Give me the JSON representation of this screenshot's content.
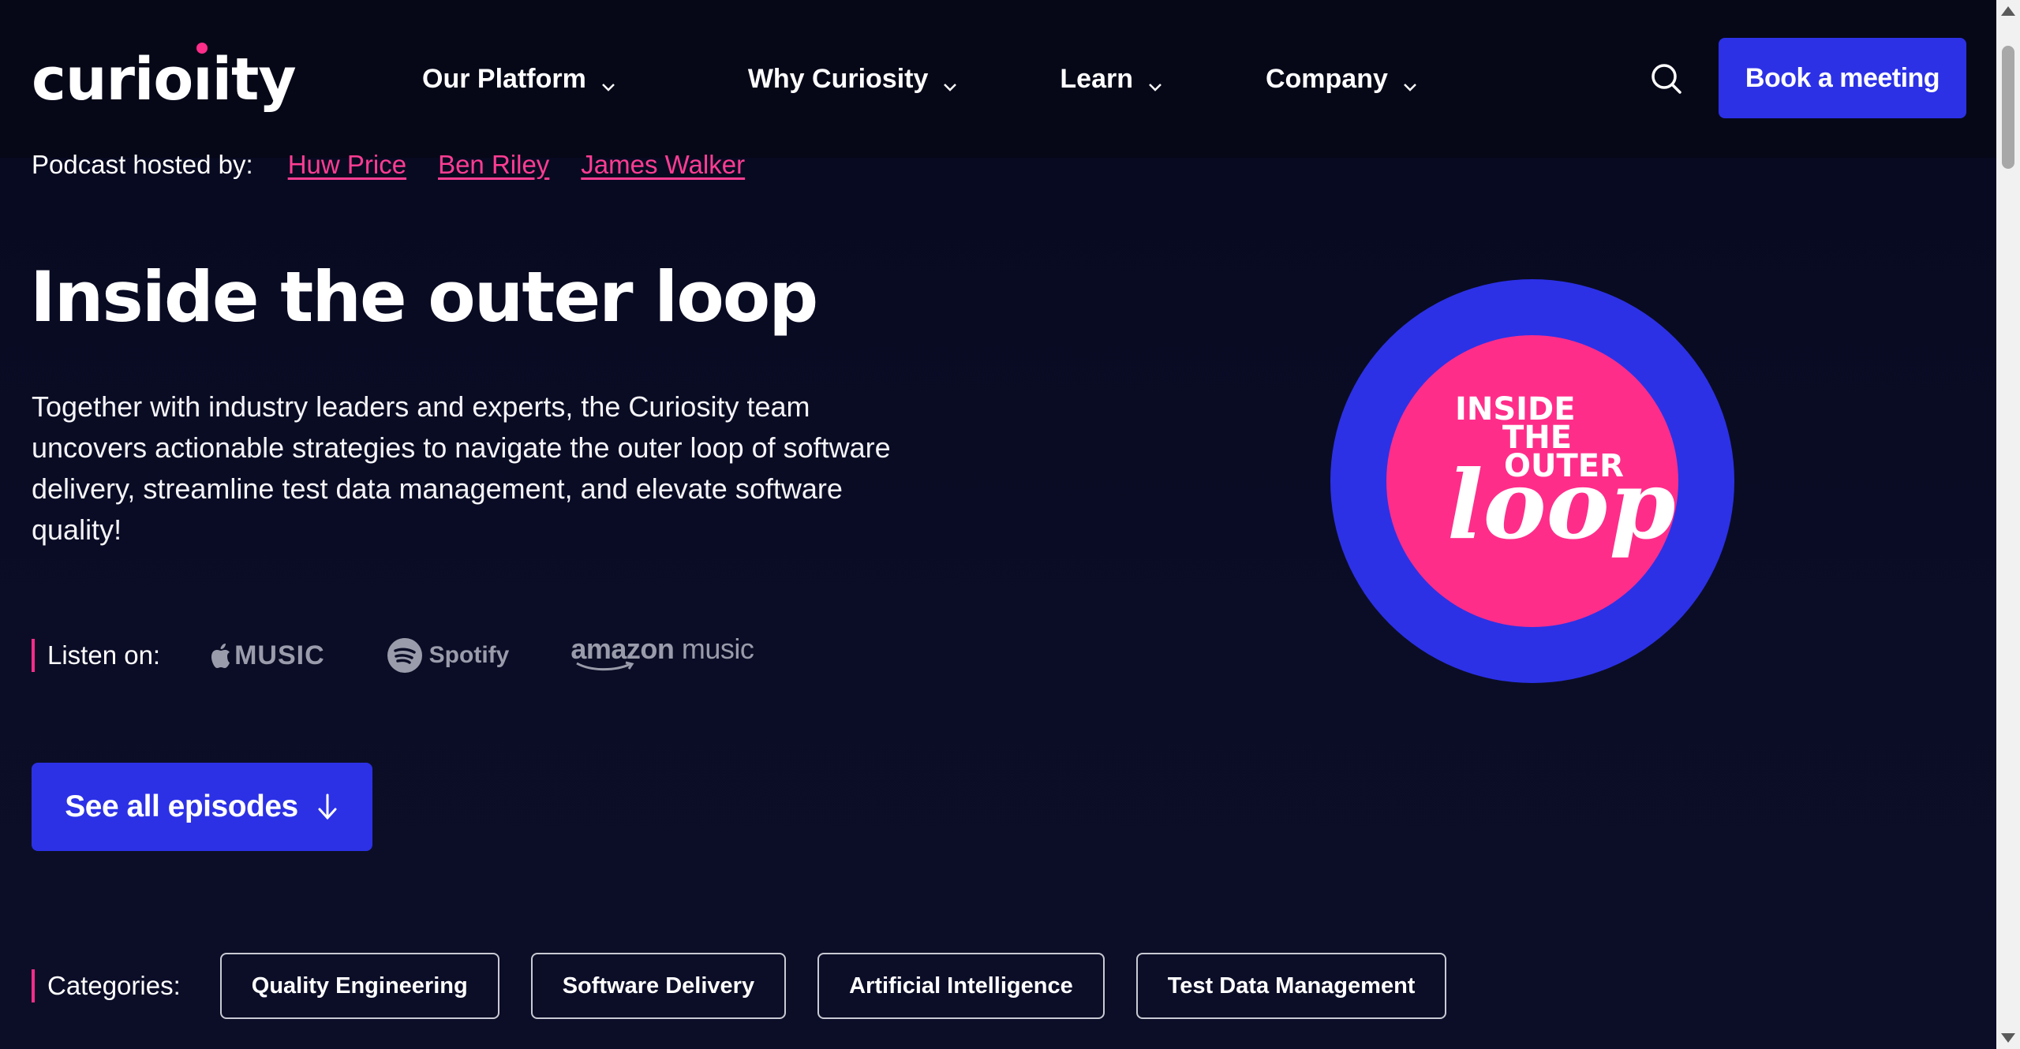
{
  "header": {
    "logo_text": "curiosity",
    "nav": [
      {
        "label": "Our Platform"
      },
      {
        "label": "Why Curiosity"
      },
      {
        "label": "Learn"
      },
      {
        "label": "Company"
      }
    ],
    "book_label": "Book a meeting",
    "search_icon": "search-icon"
  },
  "hosts": {
    "label": "Podcast hosted by:",
    "names": [
      "Huw Price",
      "Ben Riley",
      "James Walker"
    ]
  },
  "title": "Inside the outer loop",
  "description": "Together with industry leaders and experts, the Curiosity team uncovers actionable strategies to navigate the outer loop of software delivery, streamline test data management, and elevate software quality!",
  "listen": {
    "label": "Listen on:",
    "platforms": {
      "apple": "MUSIC",
      "spotify": "Spotify",
      "amazon_a": "amazon",
      "amazon_b": "music"
    }
  },
  "episodes_button": "See all episodes",
  "categories": {
    "label": "Categories:",
    "items": [
      "Quality Engineering",
      "Software Delivery",
      "Artificial Intelligence",
      "Test Data Management"
    ]
  },
  "art": {
    "line1": "INSIDE",
    "line2": "THE",
    "line3": "OUTER",
    "line4": "loop"
  },
  "colors": {
    "brand_blue": "#2c31e6",
    "brand_pink": "#ff2d8a",
    "background": "#080a1f"
  }
}
